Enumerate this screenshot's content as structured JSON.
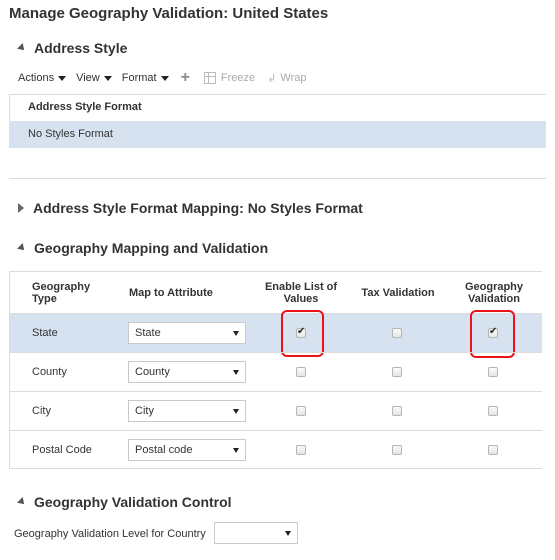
{
  "page": {
    "title": "Manage Geography Validation: United States"
  },
  "address_style": {
    "heading": "Address Style",
    "toolbar": {
      "actions": "Actions",
      "view": "View",
      "format": "Format",
      "freeze": "Freeze",
      "wrap": "Wrap"
    },
    "column_header": "Address Style Format",
    "rows": [
      "No Styles Format"
    ]
  },
  "format_mapping": {
    "heading": "Address Style Format Mapping: No Styles Format",
    "collapsed": true
  },
  "geo_mapping": {
    "heading": "Geography Mapping and Validation",
    "columns": {
      "geo_type": "Geography Type",
      "map_attr": "Map to Attribute",
      "enable_lov": "Enable List of Values",
      "tax_validation": "Tax Validation",
      "geo_validation": "Geography Validation"
    },
    "rows": [
      {
        "type": "State",
        "attribute": "State",
        "enable_lov": true,
        "tax_validation": false,
        "geo_validation": true,
        "selected": true
      },
      {
        "type": "County",
        "attribute": "County",
        "enable_lov": false,
        "tax_validation": false,
        "geo_validation": false,
        "selected": false
      },
      {
        "type": "City",
        "attribute": "City",
        "enable_lov": false,
        "tax_validation": false,
        "geo_validation": false,
        "selected": false
      },
      {
        "type": "Postal Code",
        "attribute": "Postal code",
        "enable_lov": false,
        "tax_validation": false,
        "geo_validation": false,
        "selected": false
      }
    ]
  },
  "validation_control": {
    "heading": "Geography Validation Control",
    "level_label": "Geography Validation Level for Country",
    "level_value": ""
  },
  "colors": {
    "selected_row": "#d6e2ef",
    "highlight": "#e8141a"
  }
}
